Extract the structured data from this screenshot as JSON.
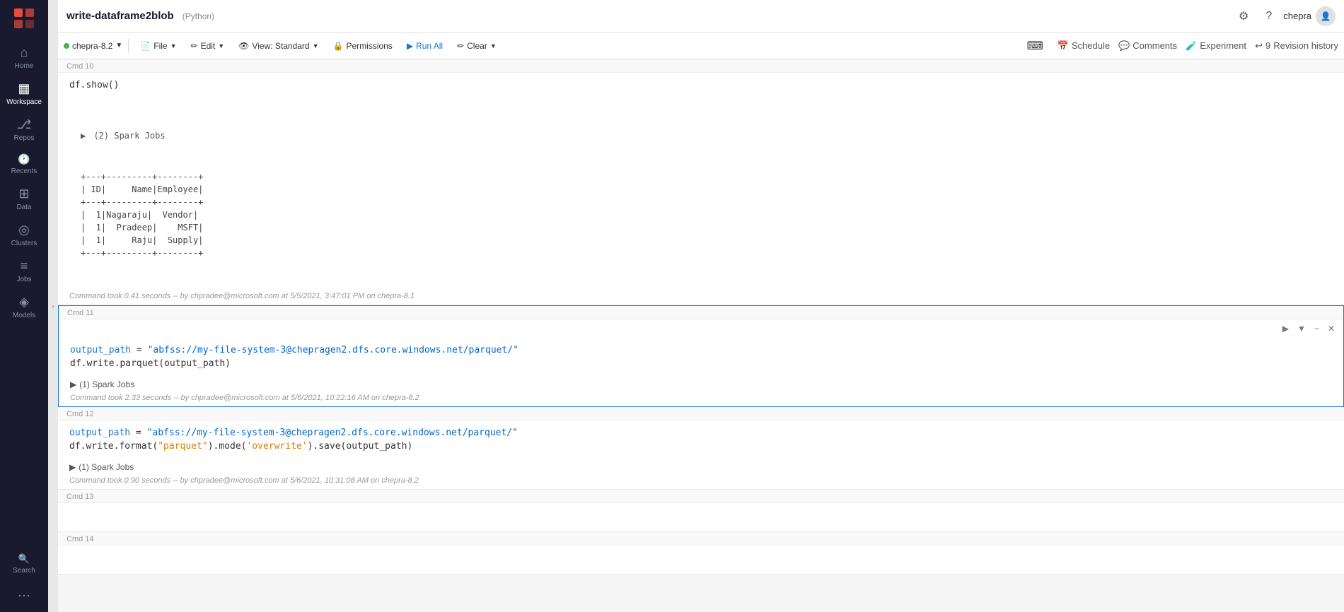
{
  "app": {
    "title": "write-dataframe2blob",
    "lang": "(Python)"
  },
  "topbar": {
    "settings_icon": "⚙",
    "help_icon": "?",
    "username": "chepra",
    "user_icon": "👤"
  },
  "toolbar": {
    "cluster_name": "chepra-8.2",
    "cluster_dot_color": "#4caf50",
    "file_label": "File",
    "edit_label": "Edit",
    "view_label": "View: Standard",
    "permissions_label": "Permissions",
    "run_all_label": "Run All",
    "clear_label": "Clear"
  },
  "topbar_right": {
    "keyboard_icon": "⌨",
    "schedule_label": "Schedule",
    "comments_label": "Comments",
    "experiment_label": "Experiment",
    "revision_history_label": "Revision history",
    "revision_count": "9"
  },
  "sidebar": {
    "items": [
      {
        "id": "home",
        "label": "Home",
        "icon": "⌂"
      },
      {
        "id": "workspace",
        "label": "Workspace",
        "icon": "▦",
        "active": true
      },
      {
        "id": "repos",
        "label": "Repos",
        "icon": "⎇"
      },
      {
        "id": "recents",
        "label": "Recents",
        "icon": "○"
      },
      {
        "id": "data",
        "label": "Data",
        "icon": "⊞"
      },
      {
        "id": "clusters",
        "label": "Clusters",
        "icon": "◎"
      },
      {
        "id": "jobs",
        "label": "Jobs",
        "icon": "≡"
      },
      {
        "id": "models",
        "label": "Models",
        "icon": "◈"
      },
      {
        "id": "search",
        "label": "Search",
        "icon": "🔍"
      }
    ]
  },
  "cells": [
    {
      "id": "cmd10",
      "cmd": "Cmd 10",
      "code": "df.show()",
      "output_lines": [
        "▶  (2) Spark Jobs",
        "+---+---------+--------+",
        "| ID|     Name|Employee|",
        "+---+---------+--------+",
        "|  1|Nagaraju|  Vendor|",
        "|  1|  Pradeep|    MSFT|",
        "|  1|     Raju|  Supply|",
        "+---+---------+--------+"
      ],
      "cmd_time": "Command took 0.41 seconds -- by chpradee@microsoft.com at 5/5/2021, 3:47:01 PM on chepra-8.1",
      "active": false
    },
    {
      "id": "cmd11",
      "cmd": "Cmd 11",
      "code_line1": "output_path = \"abfss://my-file-system-3@chepragen2.dfs.core.windows.net/parquet/\"",
      "code_line2": "df.write.parquet(output_path)",
      "spark_jobs": "▶  (1) Spark Jobs",
      "cmd_time": "Command took 2.33 seconds -- by chpradee@microsoft.com at 5/6/2021, 10:22:16 AM on chepra-8.2",
      "active": true
    },
    {
      "id": "cmd12",
      "cmd": "Cmd 12",
      "code_line1": "output_path = \"abfss://my-file-system-3@chepragen2.dfs.core.windows.net/parquet/\"",
      "code_line2": "df.write.format(\"parquet\").mode('overwrite').save(output_path)",
      "spark_jobs": "▶  (1) Spark Jobs",
      "cmd_time": "Command took 0.90 seconds -- by chpradee@microsoft.com at 5/6/2021, 10:31:08 AM on chepra-8.2",
      "active": false
    },
    {
      "id": "cmd13",
      "cmd": "Cmd 13",
      "code": "",
      "active": false
    },
    {
      "id": "cmd14",
      "cmd": "Cmd 14",
      "code": "",
      "active": false
    }
  ]
}
